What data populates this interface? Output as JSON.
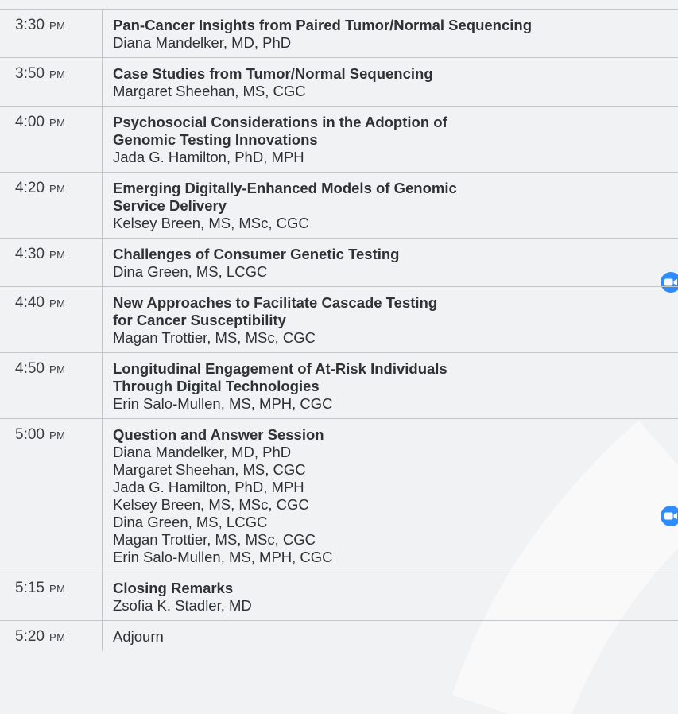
{
  "sessions": [
    {
      "time": "3:30",
      "ampm": "PM",
      "title": [
        "Pan-Cancer Insights from Paired Tumor/Normal Sequencing"
      ],
      "speakers": [
        "Diana Mandelker, MD, PhD"
      ]
    },
    {
      "time": "3:50",
      "ampm": "PM",
      "title": [
        "Case Studies from Tumor/Normal Sequencing"
      ],
      "speakers": [
        "Margaret Sheehan, MS, CGC"
      ]
    },
    {
      "time": "4:00",
      "ampm": "PM",
      "title": [
        "Psychosocial Considerations in the Adoption of",
        "Genomic Testing Innovations"
      ],
      "speakers": [
        "Jada G. Hamilton, PhD, MPH"
      ]
    },
    {
      "time": "4:20",
      "ampm": "PM",
      "title": [
        "Emerging Digitally-Enhanced Models of Genomic",
        "Service Delivery"
      ],
      "speakers": [
        "Kelsey Breen, MS, MSc, CGC"
      ]
    },
    {
      "time": "4:30",
      "ampm": "PM",
      "title": [
        "Challenges of Consumer Genetic Testing"
      ],
      "speakers": [
        "Dina Green, MS, LCGC"
      ],
      "zoom": true
    },
    {
      "time": "4:40",
      "ampm": "PM",
      "title": [
        "New Approaches to Facilitate Cascade Testing",
        "for Cancer Susceptibility"
      ],
      "speakers": [
        "Magan Trottier, MS, MSc, CGC"
      ]
    },
    {
      "time": "4:50",
      "ampm": "PM",
      "title": [
        "Longitudinal Engagement of At-Risk Individuals",
        "Through Digital Technologies"
      ],
      "speakers": [
        "Erin Salo-Mullen, MS, MPH, CGC"
      ]
    },
    {
      "time": "5:00",
      "ampm": "PM",
      "title": [
        "Question and Answer Session"
      ],
      "speakers": [
        "Diana Mandelker, MD, PhD",
        "Margaret Sheehan, MS, CGC",
        "Jada G. Hamilton, PhD, MPH",
        "Kelsey Breen, MS, MSc, CGC",
        "Dina Green, MS, LCGC",
        "Magan Trottier, MS, MSc, CGC",
        "Erin Salo-Mullen, MS, MPH, CGC"
      ],
      "zoom": true
    },
    {
      "time": "5:15",
      "ampm": "PM",
      "title": [
        "Closing Remarks"
      ],
      "speakers": [
        "Zsofia K. Stadler, MD"
      ]
    },
    {
      "time": "5:20",
      "ampm": "PM",
      "title": [],
      "speakers": [
        "Adjourn"
      ]
    }
  ],
  "zoom_icon": {
    "name": "zoom-video-icon",
    "color": "#2d8cff"
  },
  "colors": {
    "background": "#f1f2f4",
    "divider": "#c2c5ca",
    "text": "#2e3135"
  }
}
